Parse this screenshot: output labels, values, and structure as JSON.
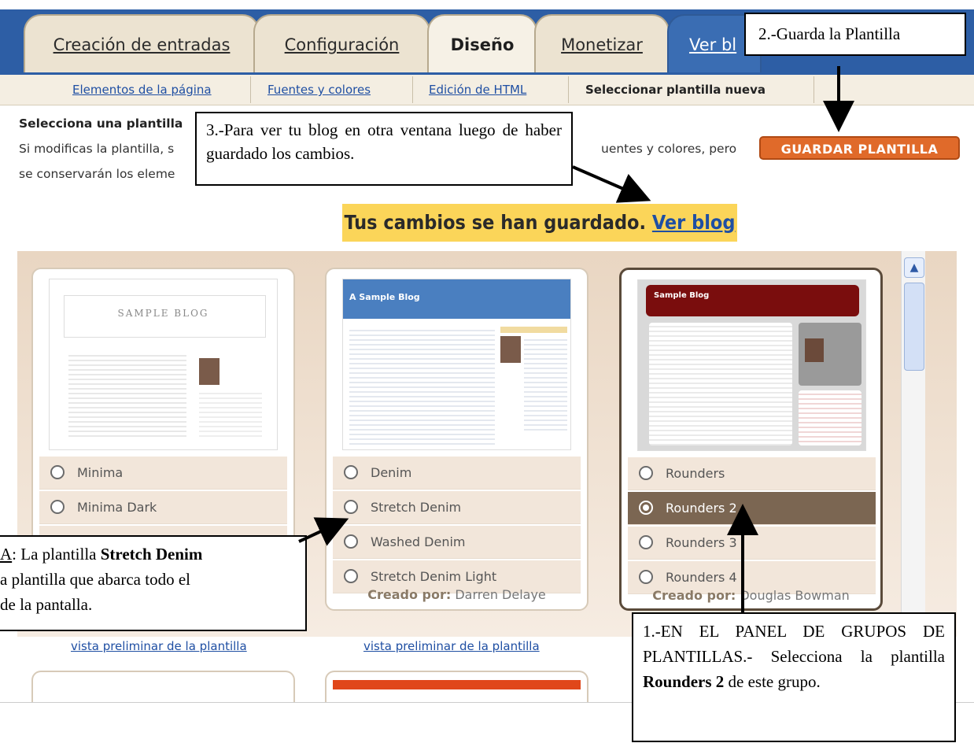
{
  "tabs": [
    {
      "label": "Creación de entradas"
    },
    {
      "label": "Configuración"
    },
    {
      "label": "Diseño"
    },
    {
      "label": "Monetizar"
    },
    {
      "label": "Ver bl"
    }
  ],
  "subtabs": [
    {
      "label": "Elementos de la página"
    },
    {
      "label": "Fuentes y colores"
    },
    {
      "label": "Edición de HTML"
    },
    {
      "label": "Seleccionar plantilla nueva"
    }
  ],
  "intro": {
    "heading": "Selecciona una plantilla",
    "line1a": "Si modificas la plantilla, s",
    "line1b": "uentes y colores, pero",
    "line2": "se conservarán los eleme"
  },
  "save_button": "GUARDAR PLANTILLA",
  "notice": {
    "text": "Tus cambios se han guardado.",
    "link": "Ver blog"
  },
  "cards": [
    {
      "thumb_title": "SAMPLE BLOG",
      "options": [
        "Minima",
        "Minima Dark"
      ],
      "preview": "vista preliminar de la plantilla"
    },
    {
      "thumb_title": "A Sample Blog",
      "options": [
        "Denim",
        "Stretch Denim",
        "Washed Denim",
        "Stretch Denim Light"
      ],
      "creator_label": "Creado por:",
      "creator_name": "Darren Delaye",
      "preview": "vista preliminar de la plantilla"
    },
    {
      "thumb_title": "Sample Blog",
      "options": [
        "Rounders",
        "Rounders 2",
        "Rounders 3",
        "Rounders 4"
      ],
      "selected": "Rounders 2",
      "creator_label": "Creado por:",
      "creator_name": "Douglas Bowman"
    }
  ],
  "callouts": {
    "c2": "2.-Guarda la Plantilla",
    "c3": "3.-Para ver tu blog en otra ventana luego de haber guardado los cambios.",
    "cA_prefix": "A",
    "cA_1": ": La plantilla ",
    "cA_bold": "Stretch Denim",
    "cA_2": "a plantilla que abarca todo el",
    "cA_3": "de la pantalla.",
    "c1_a": "1.-EN EL PANEL DE GRUPOS DE PLANTILLAS.- Selecciona la plantilla",
    "c1_bold": "Rounders 2",
    "c1_b": " de este grupo."
  }
}
